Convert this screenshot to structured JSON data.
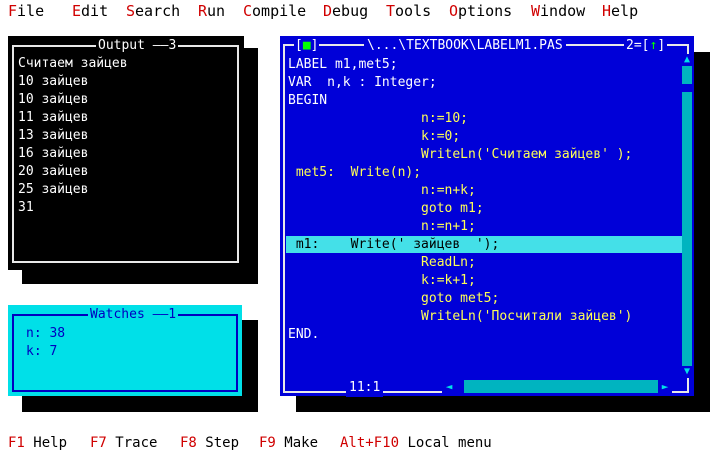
{
  "menu": {
    "items": [
      {
        "hotkey": "F",
        "rest": "ile"
      },
      {
        "hotkey": "E",
        "rest": "dit"
      },
      {
        "hotkey": "S",
        "rest": "earch"
      },
      {
        "hotkey": "R",
        "rest": "un"
      },
      {
        "hotkey": "C",
        "rest": "ompile"
      },
      {
        "hotkey": "D",
        "rest": "ebug"
      },
      {
        "hotkey": "T",
        "rest": "ools"
      },
      {
        "hotkey": "O",
        "rest": "ptions"
      },
      {
        "hotkey": "W",
        "rest": "indow"
      },
      {
        "hotkey": "H",
        "rest": "elp"
      }
    ]
  },
  "output_window": {
    "title": "Output",
    "number": "3",
    "lines": [
      "Считаем зайцев",
      "10 зайцев",
      "10 зайцев",
      "11 зайцев",
      "13 зайцев",
      "16 зайцев",
      "20 зайцев",
      "25 зайцев",
      "31"
    ]
  },
  "watches_window": {
    "title": "Watches",
    "number": "1",
    "lines": [
      "n: 38",
      "k: 7"
    ]
  },
  "editor_window": {
    "close_marker": "■",
    "path": "\\...\\TEXTBOOK\\LABELM1.PAS",
    "number": "2",
    "zoom_marker": "↑",
    "cursor_pos": "11:1",
    "lines": [
      "LABEL m1,met5;",
      "VAR  n,k : Integer;",
      "BEGIN",
      "                 n:=10;",
      "                 k:=0;",
      "                 WriteLn('Считаем зайцев' );",
      " met5:  Write(n);",
      "                 n:=n+k;",
      "                 goto m1;",
      "                 n:=n+1;",
      " m1:    Write(' зайцев  ');",
      "                 ReadLn;",
      "                 k:=k+1;",
      "                 goto met5;",
      "                 WriteLn('Посчитали зайцев')",
      "END."
    ],
    "highlighted_line_index": 10
  },
  "status": {
    "items": [
      {
        "key": "F1",
        "label": " Help"
      },
      {
        "key": "F7",
        "label": " Trace"
      },
      {
        "key": "F8",
        "label": " Step"
      },
      {
        "key": "F9",
        "label": " Make"
      },
      {
        "key": "Alt+F10",
        "label": " Local menu"
      }
    ]
  },
  "colors": {
    "editor_bg": "#0000d8",
    "editor_text": "#ffff55",
    "editor_highlight": "#44e0e8",
    "output_bg": "#000000",
    "output_text": "#ffffff",
    "watches_bg": "#00e0e8",
    "watches_text": "#0000c0",
    "hotkey": "#d00000"
  }
}
